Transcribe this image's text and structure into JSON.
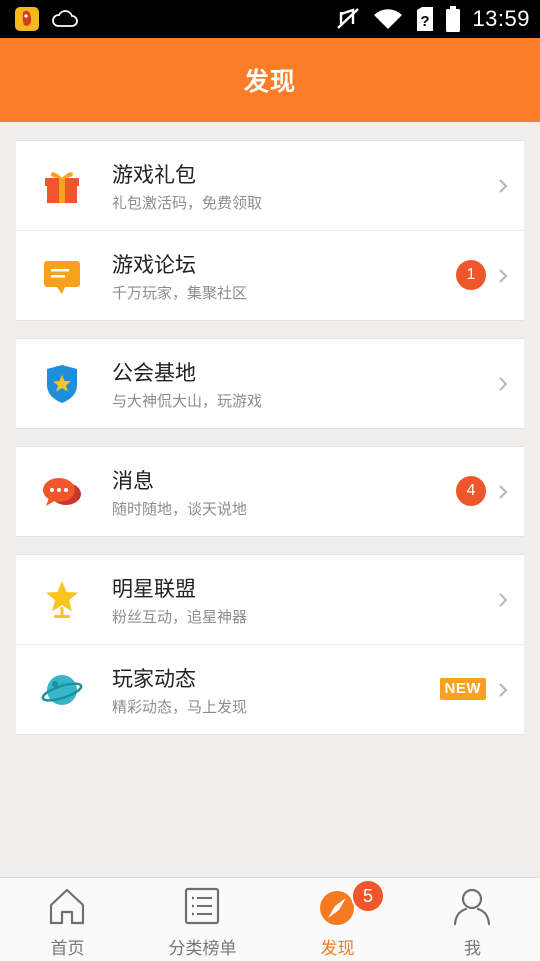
{
  "status_bar": {
    "time": "13:59"
  },
  "header": {
    "title": "发现"
  },
  "groups": [
    {
      "items": [
        {
          "title": "游戏礼包",
          "subtitle": "礼包激活码，免费领取"
        },
        {
          "title": "游戏论坛",
          "subtitle": "千万玩家，集聚社区",
          "badge": "1"
        }
      ]
    },
    {
      "items": [
        {
          "title": "公会基地",
          "subtitle": "与大神侃大山，玩游戏"
        }
      ]
    },
    {
      "items": [
        {
          "title": "消息",
          "subtitle": "随时随地，谈天说地",
          "badge": "4"
        }
      ]
    },
    {
      "items": [
        {
          "title": "明星联盟",
          "subtitle": "粉丝互动，追星神器"
        },
        {
          "title": "玩家动态",
          "subtitle": "精彩动态，马上发现",
          "tag": "NEW"
        }
      ]
    }
  ],
  "tabs": [
    {
      "label": "首页",
      "icon": "home-icon"
    },
    {
      "label": "分类榜单",
      "icon": "list-icon"
    },
    {
      "label": "发现",
      "icon": "compass-icon",
      "badge": "5",
      "active": true
    },
    {
      "label": "我",
      "icon": "person-icon"
    }
  ],
  "colors": {
    "accent": "#fb7d28",
    "badge": "#f0562b",
    "new_tag": "#f7a11c"
  }
}
